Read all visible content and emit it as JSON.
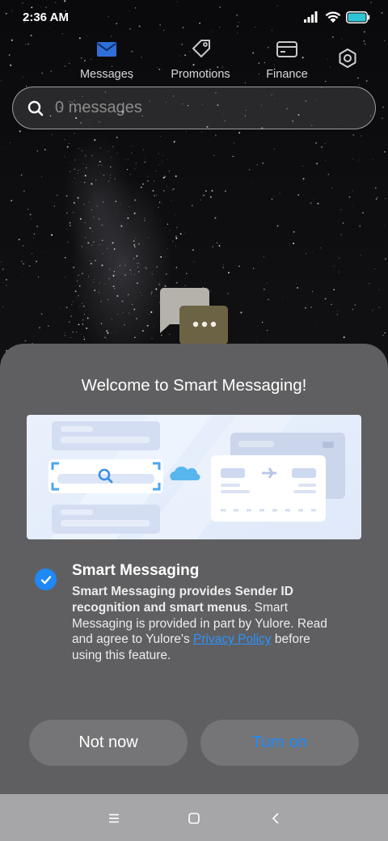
{
  "status_bar": {
    "time": "2:36 AM",
    "icons": [
      "signal-icon",
      "wifi-icon",
      "battery-icon"
    ]
  },
  "tabs": [
    {
      "label": "Messages",
      "icon": "envelope-icon",
      "active": true
    },
    {
      "label": "Promotions",
      "icon": "tag-icon",
      "active": false
    },
    {
      "label": "Finance",
      "icon": "card-icon",
      "active": false
    }
  ],
  "settings": {
    "icon": "gear-icon"
  },
  "search": {
    "placeholder": "0 messages",
    "icon": "search-icon"
  },
  "sheet": {
    "title": "Welcome to Smart Messaging!",
    "feature_title": "Smart Messaging",
    "checked": true,
    "desc_bold": "Smart Messaging provides Sender ID recognition and smart menus",
    "desc_after_bold": ". Smart Messaging is provided in part by Yulore. Read and agree to Yulore's ",
    "desc_link": "Privacy Policy",
    "desc_end": " before using this feature.",
    "buttons": {
      "not_now": "Not now",
      "turn_on": "Turn on"
    }
  },
  "colors": {
    "accent": "#1a8cff",
    "sheet_bg": "#5f5f61",
    "button_bg": "#757577",
    "tab_active": "#2f6fd8"
  },
  "navbar": {
    "icons": [
      "menu-icon",
      "home-icon",
      "back-icon"
    ]
  }
}
